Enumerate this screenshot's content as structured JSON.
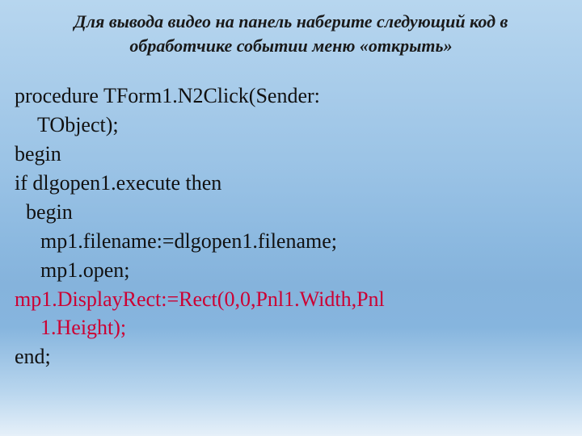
{
  "title": "Для вывода видео на панель наберите следующий код в обработчике событии меню «открыть»",
  "code": {
    "line1a": "procedure TForm1.N2Click(Sender:",
    "line1b": "TObject);",
    "line2": "begin",
    "line3": "if dlgopen1.execute then",
    "line4": "begin",
    "line5": "mp1.filename:=dlgopen1.filename;",
    "line6": "mp1.open;",
    "line7a": "mp1.DisplayRect:=Rect(0,0,Pnl1.Width,Pnl",
    "line7b": "1.Height);",
    "line8": "end;"
  }
}
